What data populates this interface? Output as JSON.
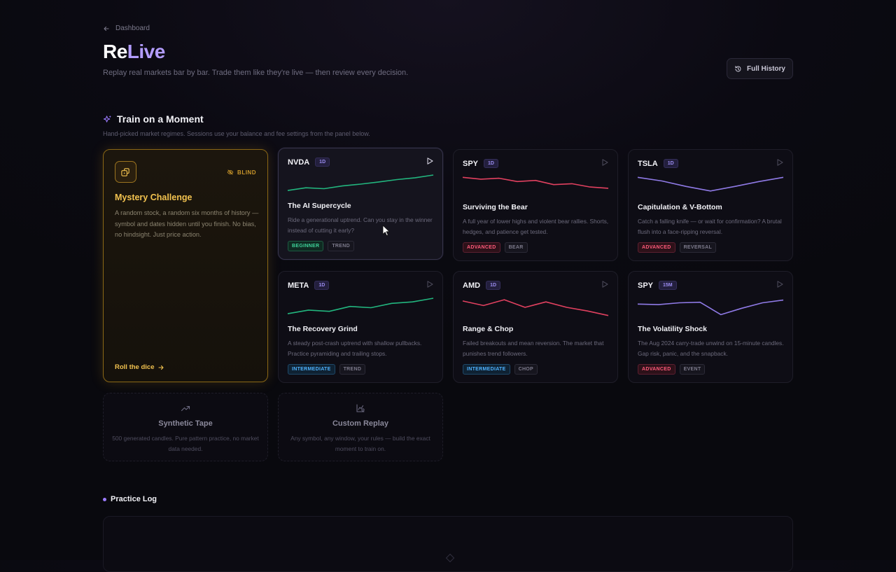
{
  "back": {
    "label": "Dashboard"
  },
  "header": {
    "title_prefix": "Re",
    "title_accent": "Live",
    "subtitle": "Replay real markets bar by bar. Trade them like they're live — then review every decision.",
    "history_button": "Full History"
  },
  "section": {
    "title": "Train on a Moment",
    "subtitle": "Hand-picked market regimes. Sessions use your balance and fee settings from the panel below."
  },
  "mystery": {
    "badge": "BLIND",
    "title": "Mystery Challenge",
    "description": "A random stock, a random six months of history — symbol and dates hidden until you finish. No bias, no hindsight. Just price action.",
    "cta": "Roll the dice"
  },
  "cards": [
    {
      "symbol": "NVDA",
      "timeframe": "1D",
      "title": "The AI Supercycle",
      "description": "Ride a generational uptrend. Can you stay in the winner instead of cutting it early?",
      "tags": [
        "BEGINNER",
        "TREND"
      ],
      "spark_color": "#22b57e",
      "spark": [
        0.15,
        0.3,
        0.25,
        0.4,
        0.5,
        0.62,
        0.75,
        0.85,
        1.0
      ]
    },
    {
      "symbol": "SPY",
      "timeframe": "1D",
      "title": "Surviving the Bear",
      "description": "A full year of lower highs and violent bear rallies. Shorts, hedges, and patience get tested.",
      "tags": [
        "ADVANCED",
        "BEAR"
      ],
      "spark_color": "#e0405f",
      "spark": [
        0.95,
        0.85,
        0.9,
        0.72,
        0.78,
        0.55,
        0.6,
        0.42,
        0.35
      ]
    },
    {
      "symbol": "TSLA",
      "timeframe": "1D",
      "title": "Capitulation & V-Bottom",
      "description": "Catch a falling knife — or wait for confirmation? A brutal flush into a face-ripping reversal.",
      "tags": [
        "ADVANCED",
        "REVERSAL"
      ],
      "spark_color": "#8f7ae6",
      "spark": [
        0.95,
        0.75,
        0.45,
        0.2,
        0.45,
        0.72,
        0.95
      ]
    },
    {
      "symbol": "META",
      "timeframe": "1D",
      "title": "The Recovery Grind",
      "description": "A steady post-crash uptrend with shallow pullbacks. Practice pyramiding and trailing stops.",
      "tags": [
        "INTERMEDIATE",
        "TREND"
      ],
      "spark_color": "#22b57e",
      "spark": [
        0.15,
        0.35,
        0.28,
        0.55,
        0.48,
        0.72,
        0.8,
        1.0
      ]
    },
    {
      "symbol": "AMD",
      "timeframe": "1D",
      "title": "Range & Chop",
      "description": "Failed breakouts and mean reversion. The market that punishes trend followers.",
      "tags": [
        "INTERMEDIATE",
        "CHOP"
      ],
      "spark_color": "#e0405f",
      "spark": [
        0.85,
        0.6,
        0.92,
        0.5,
        0.8,
        0.5,
        0.3,
        0.05
      ]
    },
    {
      "symbol": "SPY",
      "timeframe": "15M",
      "title": "The Volatility Shock",
      "description": "The Aug 2024 carry-trade unwind on 15-minute candles. Gap risk, panic, and the snapback.",
      "tags": [
        "ADVANCED",
        "EVENT"
      ],
      "spark_color": "#8f7ae6",
      "spark": [
        0.68,
        0.65,
        0.75,
        0.78,
        0.1,
        0.45,
        0.75,
        0.9
      ]
    }
  ],
  "synthetic": {
    "title": "Synthetic Tape",
    "description": "500 generated candles. Pure pattern practice, no market data needed."
  },
  "custom": {
    "title": "Custom Replay",
    "description": "Any symbol, any window, your rules — build the exact moment to train on."
  },
  "log": {
    "title": "Practice Log"
  }
}
